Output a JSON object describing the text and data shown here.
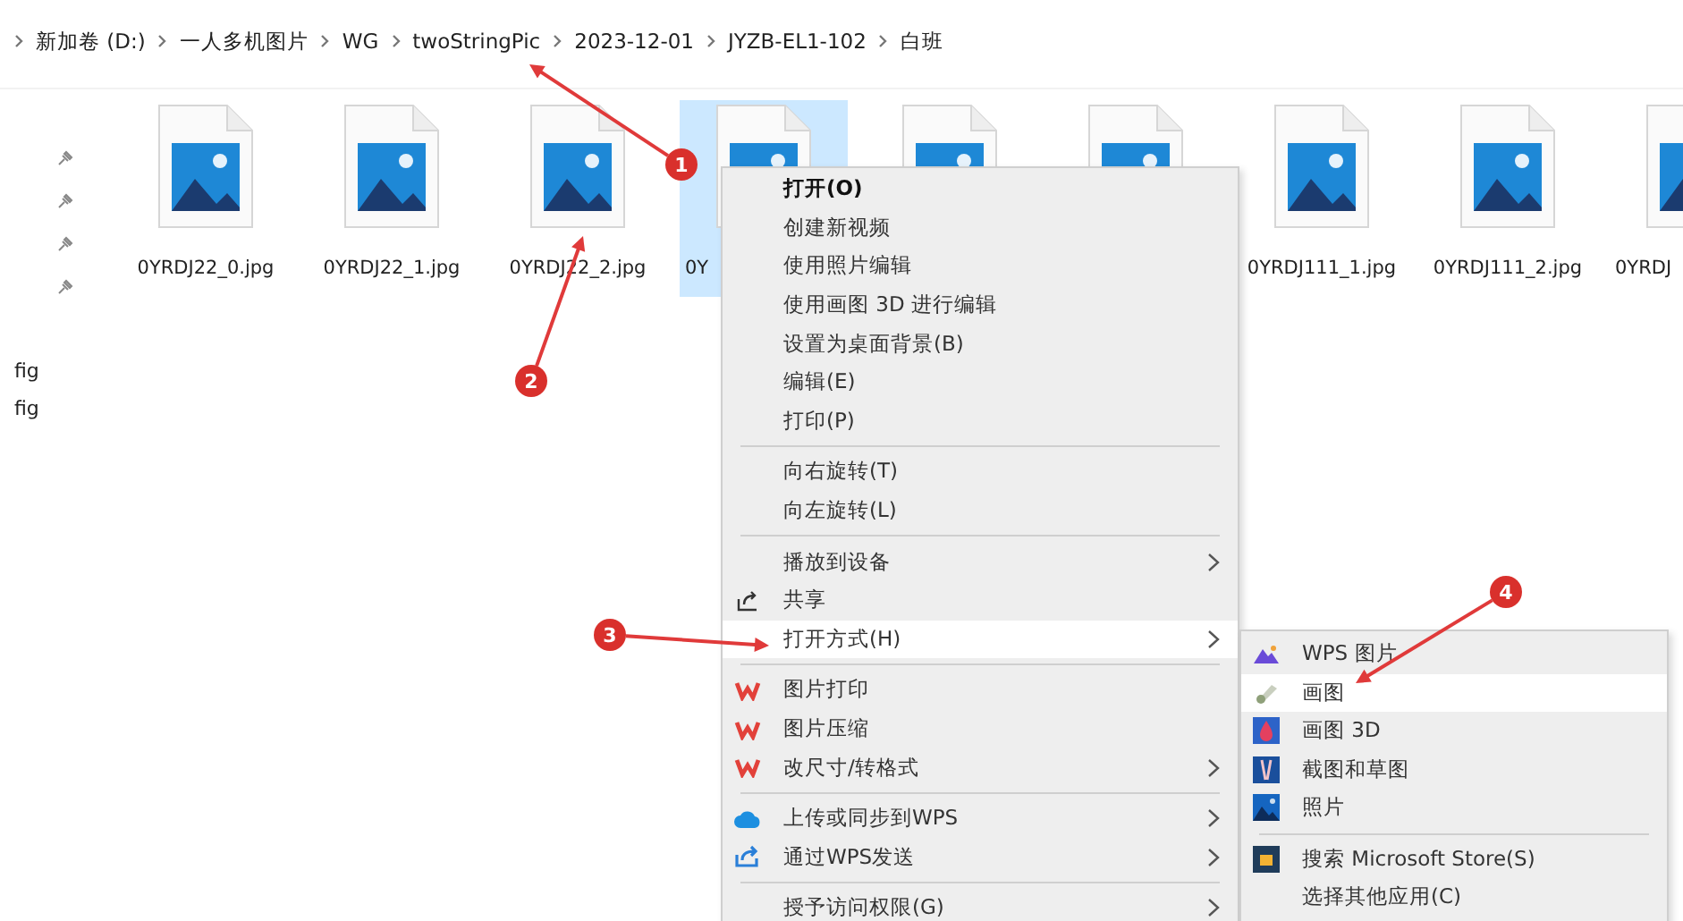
{
  "breadcrumb": [
    "新加卷 (D:)",
    "一人多机图片",
    "WG",
    "twoStringPic",
    "2023-12-01",
    "JYZB-EL1-102",
    "白班"
  ],
  "nav_items": [
    "fig",
    "fig"
  ],
  "files": [
    {
      "name": "0YRDJ22_0.jpg",
      "selected": false
    },
    {
      "name": "0YRDJ22_1.jpg",
      "selected": false
    },
    {
      "name": "0YRDJ22_2.jpg",
      "selected": false
    },
    {
      "name": "0Y",
      "selected": true
    },
    {
      "selected": false
    },
    {
      "selected": false
    },
    {
      "name": "0YRDJ111_1.jpg",
      "selected": false
    },
    {
      "name": "0YRDJ111_2.jpg",
      "selected": false
    },
    {
      "name": "0YRDJ",
      "selected": false
    }
  ],
  "context_menu": {
    "items": [
      {
        "kind": "item",
        "label": "打开(O)",
        "bold": true,
        "submenu": false,
        "selected": false
      },
      {
        "kind": "item",
        "label": "创建新视频",
        "submenu": false,
        "selected": false
      },
      {
        "kind": "item",
        "label": "使用照片编辑",
        "submenu": false,
        "selected": false
      },
      {
        "kind": "item",
        "label": "使用画图 3D 进行编辑",
        "submenu": false,
        "selected": false
      },
      {
        "kind": "item",
        "label": "设置为桌面背景(B)",
        "submenu": false,
        "selected": false
      },
      {
        "kind": "item",
        "label": "编辑(E)",
        "submenu": false,
        "selected": false
      },
      {
        "kind": "item",
        "label": "打印(P)",
        "submenu": false,
        "selected": false
      },
      {
        "kind": "separator"
      },
      {
        "kind": "item",
        "label": "向右旋转(T)",
        "submenu": false,
        "selected": false
      },
      {
        "kind": "item",
        "label": "向左旋转(L)",
        "submenu": false,
        "selected": false
      },
      {
        "kind": "separator"
      },
      {
        "kind": "item",
        "label": "播放到设备",
        "submenu": true,
        "selected": false
      },
      {
        "kind": "item",
        "label": "共享",
        "submenu": false,
        "selected": false
      },
      {
        "kind": "item",
        "label": "打开方式(H)",
        "submenu": true,
        "selected": true
      },
      {
        "kind": "separator"
      },
      {
        "kind": "item",
        "label": "图片打印",
        "submenu": false,
        "selected": false
      },
      {
        "kind": "item",
        "label": "图片压缩",
        "submenu": false,
        "selected": false
      },
      {
        "kind": "item",
        "label": "改尺寸/转格式",
        "submenu": true,
        "selected": false
      },
      {
        "kind": "separator"
      },
      {
        "kind": "item",
        "label": "上传或同步到WPS",
        "submenu": true,
        "selected": false
      },
      {
        "kind": "item",
        "label": "通过WPS发送",
        "submenu": true,
        "selected": false
      },
      {
        "kind": "separator"
      },
      {
        "kind": "item",
        "label": "授予访问权限(G)",
        "submenu": true,
        "selected": false
      }
    ]
  },
  "open_with_menu": {
    "items": [
      {
        "kind": "item",
        "label": "WPS 图片",
        "selected": false
      },
      {
        "kind": "item",
        "label": "画图",
        "selected": true
      },
      {
        "kind": "item",
        "label": "画图 3D",
        "selected": false
      },
      {
        "kind": "item",
        "label": "截图和草图",
        "selected": false
      },
      {
        "kind": "item",
        "label": "照片",
        "selected": false
      },
      {
        "kind": "separator"
      },
      {
        "kind": "item",
        "label": "搜索 Microsoft Store(S)",
        "selected": false
      },
      {
        "kind": "item",
        "label": "选择其他应用(C)",
        "selected": false
      }
    ]
  },
  "annotations": [
    {
      "label": "1"
    },
    {
      "label": "2"
    },
    {
      "label": "3"
    },
    {
      "label": "4"
    }
  ]
}
